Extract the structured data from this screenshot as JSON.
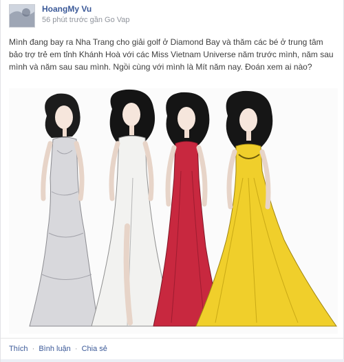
{
  "post": {
    "author_name": "HoangMy Vu",
    "timestamp": "56 phút trước gần Go Vap",
    "privacy_icon": "globe-icon",
    "message": "Mình đang bay ra Nha Trang cho giải golf ở Diamond Bay và thăm các bé ở trung tâm bảo trợ trẻ em tỉnh Khánh Hoà với các Miss Vietnam Universe năm trước mình, năm sau mình và năm sau sau mình. Ngồi cùng với mình là Mít năm nay. Đoán xem ai nào?",
    "image": {
      "description_icon": "fashion-sketch-image",
      "dress_colors": [
        "#d8d8dc",
        "#f2f2f0",
        "#c8283f",
        "#f0cf2b"
      ]
    }
  },
  "actions": {
    "like": "Thích",
    "comment": "Bình luận",
    "share": "Chia sẻ",
    "separator": "·"
  },
  "colors": {
    "link": "#3b5998",
    "muted": "#90949c"
  }
}
